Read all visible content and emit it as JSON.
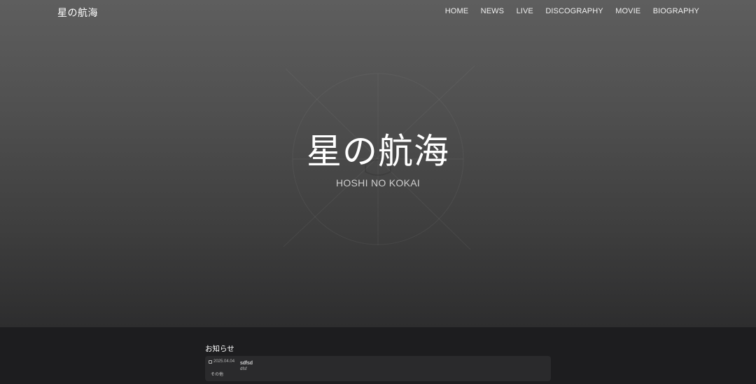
{
  "header": {
    "logo": "星の航海",
    "nav": [
      {
        "label": "HOME"
      },
      {
        "label": "NEWS"
      },
      {
        "label": "LIVE"
      },
      {
        "label": "DISCOGRAPHY"
      },
      {
        "label": "MOVIE"
      },
      {
        "label": "BIOGRAPHY"
      }
    ]
  },
  "hero": {
    "title": "星の航海",
    "subtitle": "HOSHI NO KOKAI"
  },
  "news": {
    "heading": "お知らせ",
    "items": [
      {
        "date": "2025.04.04",
        "category": "その他",
        "title": "sdfsd",
        "body": "dfsf"
      }
    ]
  },
  "colors": {
    "hero_top": "#5e5e5e",
    "hero_bottom": "#2d2d2e",
    "section_bg": "#1d1d1f",
    "card_bg": "#2a2a2c"
  },
  "icons": {
    "news_date": "calendar-icon"
  }
}
